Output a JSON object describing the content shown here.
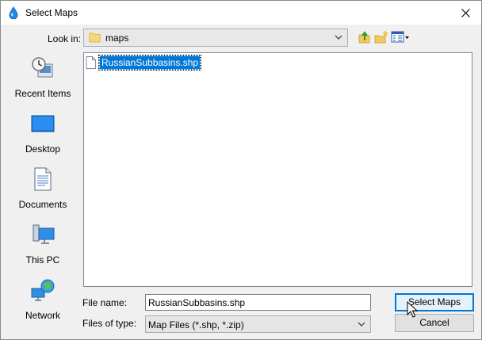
{
  "window": {
    "title": "Select Maps",
    "title_icon": "droplet-icon",
    "close_glyph": "✕"
  },
  "lookin": {
    "label": "Look in:",
    "value": "maps"
  },
  "toolbar": {
    "icons": [
      "up-folder-icon",
      "new-folder-icon",
      "view-menu-icon"
    ]
  },
  "places": [
    {
      "label": "Recent Items",
      "icon": "recent-items-icon"
    },
    {
      "label": "Desktop",
      "icon": "desktop-icon"
    },
    {
      "label": "Documents",
      "icon": "documents-icon"
    },
    {
      "label": "This PC",
      "icon": "this-pc-icon"
    },
    {
      "label": "Network",
      "icon": "network-icon"
    }
  ],
  "files": [
    {
      "name": "RussianSubbasins.shp",
      "selected": true
    }
  ],
  "filename": {
    "label": "File name:",
    "value": "RussianSubbasins.shp"
  },
  "filetype": {
    "label": "Files of type:",
    "value": "Map Files (*.shp, *.zip)"
  },
  "buttons": {
    "select": "Select Maps",
    "cancel": "Cancel"
  },
  "colors": {
    "selection": "#0078d7",
    "default_button_border": "#0078d7"
  }
}
